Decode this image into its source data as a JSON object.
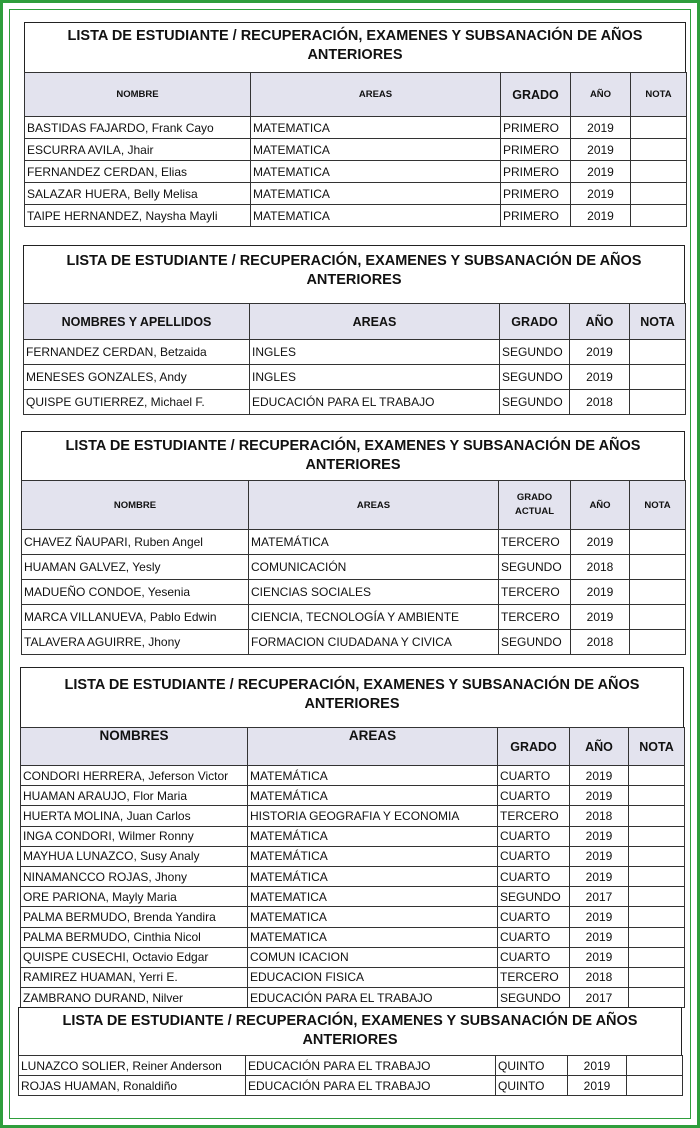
{
  "sections": [
    {
      "title": "LISTA DE ESTUDIANTE / RECUPERACIÓN, EXAMENES Y SUBSANACIÓN DE AÑOS ANTERIORES",
      "headers": [
        "NOMBRE",
        "AREAS",
        "GRADO",
        "AÑO",
        "NOTA"
      ],
      "rows": [
        [
          "BASTIDAS FAJARDO, Frank Cayo",
          "MATEMATICA",
          "PRIMERO",
          "2019",
          ""
        ],
        [
          "ESCURRA AVILA, Jhair",
          "MATEMATICA",
          "PRIMERO",
          "2019",
          ""
        ],
        [
          "FERNANDEZ CERDAN, Elias",
          "MATEMATICA",
          "PRIMERO",
          "2019",
          ""
        ],
        [
          "SALAZAR HUERA, Belly Melisa",
          "MATEMATICA",
          "PRIMERO",
          "2019",
          ""
        ],
        [
          "TAIPE HERNANDEZ, Naysha Mayli",
          "MATEMATICA",
          "PRIMERO",
          "2019",
          ""
        ]
      ]
    },
    {
      "title": "LISTA DE ESTUDIANTE / RECUPERACIÓN, EXAMENES Y SUBSANACIÓN DE AÑOS ANTERIORES",
      "headers": [
        "NOMBRES Y APELLIDOS",
        "AREAS",
        "GRADO",
        "AÑO",
        "NOTA"
      ],
      "rows": [
        [
          "FERNANDEZ CERDAN, Betzaida",
          "INGLES",
          "SEGUNDO",
          "2019",
          ""
        ],
        [
          "MENESES GONZALES, Andy",
          "INGLES",
          "SEGUNDO",
          "2019",
          ""
        ],
        [
          "QUISPE GUTIERREZ, Michael F.",
          "EDUCACIÓN PARA EL TRABAJO",
          "SEGUNDO",
          "2018",
          ""
        ]
      ]
    },
    {
      "title": "LISTA DE ESTUDIANTE / RECUPERACIÓN, EXAMENES Y SUBSANACIÓN DE AÑOS ANTERIORES",
      "headers": [
        "NOMBRE",
        "AREAS",
        "GRADO ACTUAL",
        "AÑO",
        "NOTA"
      ],
      "rows": [
        [
          "CHAVEZ ÑAUPARI, Ruben Angel",
          "MATEMÁTICA",
          "TERCERO",
          "2019",
          ""
        ],
        [
          "HUAMAN GALVEZ, Yesly",
          "COMUNICACIÓN",
          "SEGUNDO",
          "2018",
          ""
        ],
        [
          "MADUEÑO CONDOE, Yesenia",
          "CIENCIAS SOCIALES",
          "TERCERO",
          "2019",
          ""
        ],
        [
          "MARCA VILLANUEVA, Pablo Edwin",
          "CIENCIA, TECNOLOGÍA Y AMBIENTE",
          "TERCERO",
          "2019",
          ""
        ],
        [
          "TALAVERA AGUIRRE, Jhony",
          "FORMACION CIUDADANA Y CIVICA",
          "SEGUNDO",
          "2018",
          ""
        ]
      ]
    },
    {
      "title": "LISTA DE ESTUDIANTE / RECUPERACIÓN, EXAMENES Y SUBSANACIÓN DE AÑOS ANTERIORES",
      "headers": [
        "NOMBRES",
        "AREAS",
        "GRADO",
        "AÑO",
        "NOTA"
      ],
      "rows": [
        [
          "CONDORI HERRERA, Jeferson Victor",
          "MATEMÁTICA",
          "CUARTO",
          "2019",
          ""
        ],
        [
          "HUAMAN ARAUJO, Flor Maria",
          "MATEMÁTICA",
          "CUARTO",
          "2019",
          ""
        ],
        [
          "HUERTA MOLINA, Juan Carlos",
          "HISTORIA GEOGRAFIA Y ECONOMIA",
          "TERCERO",
          "2018",
          ""
        ],
        [
          "INGA CONDORI, Wilmer Ronny",
          "MATEMÁTICA",
          "CUARTO",
          "2019",
          ""
        ],
        [
          "MAYHUA LUNAZCO, Susy Analy",
          "MATEMÁTICA",
          "CUARTO",
          "2019",
          ""
        ],
        [
          "NINAMANCCO ROJAS, Jhony",
          "MATEMÁTICA",
          "CUARTO",
          "2019",
          ""
        ],
        [
          "ORE PARIONA, Mayly Maria",
          "MATEMATICA",
          "SEGUNDO",
          "2017",
          ""
        ],
        [
          "PALMA BERMUDO, Brenda Yandira",
          "MATEMATICA",
          "CUARTO",
          "2019",
          ""
        ],
        [
          "PALMA BERMUDO, Cinthia Nicol",
          "MATEMATICA",
          "CUARTO",
          "2019",
          ""
        ],
        [
          "QUISPE CUSECHI, Octavio Edgar",
          "COMUN ICACION",
          "CUARTO",
          "2019",
          ""
        ],
        [
          "RAMIREZ HUAMAN, Yerri E.",
          "EDUCACION FISICA",
          "TERCERO",
          "2018",
          ""
        ],
        [
          "ZAMBRANO DURAND, Nilver",
          "EDUCACIÓN PARA EL TRABAJO",
          "SEGUNDO",
          "2017",
          ""
        ]
      ]
    },
    {
      "title": "LISTA DE ESTUDIANTE / RECUPERACIÓN, EXAMENES Y SUBSANACIÓN DE AÑOS ANTERIORES",
      "headers": [],
      "rows": [
        [
          "LUNAZCO SOLIER, Reiner Anderson",
          "EDUCACIÓN PARA EL TRABAJO",
          "QUINTO",
          "2019",
          ""
        ],
        [
          "ROJAS HUAMAN, Ronaldiño",
          "EDUCACIÓN PARA EL TRABAJO",
          "QUINTO",
          "2019",
          ""
        ]
      ]
    }
  ],
  "colors": {
    "frame": "#2e9e3c",
    "header_bg": "#e3e3ee"
  }
}
